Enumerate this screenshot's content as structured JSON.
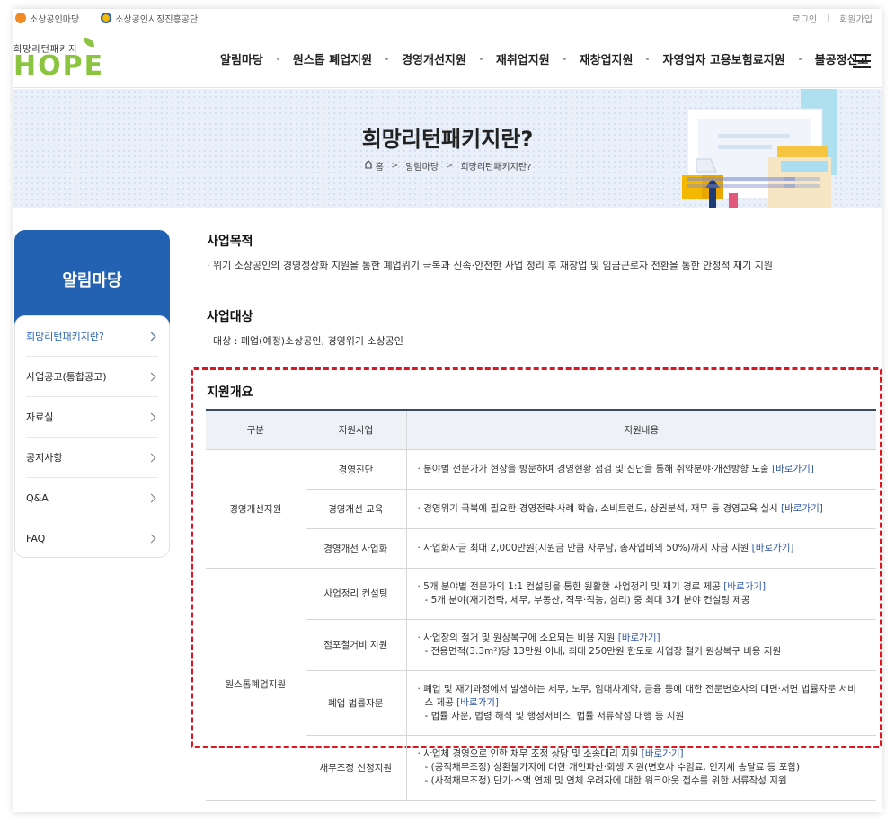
{
  "util": {
    "org1": "소상공인마당",
    "org2": "소상공인시장진흥공단",
    "login": "로그인",
    "join": "회원가입"
  },
  "logo": {
    "sub": "희망리턴패키지",
    "word": "HOPE"
  },
  "gnb": [
    "알림마당",
    "원스톱 폐업지원",
    "경영개선지원",
    "재취업지원",
    "재창업지원",
    "자영업자 고용보험료지원",
    "불공정신고"
  ],
  "banner": {
    "title": "희망리턴패키지란?",
    "breadcrumb": [
      "홈",
      "알림마당",
      "희망리턴패키지란?"
    ]
  },
  "sidebar": {
    "title": "알림마당",
    "items": [
      {
        "label": "희망리턴패키지란?",
        "active": true
      },
      {
        "label": "사업공고(통합공고)",
        "active": false
      },
      {
        "label": "자료실",
        "active": false
      },
      {
        "label": "공지사항",
        "active": false
      },
      {
        "label": "Q&A",
        "active": false
      },
      {
        "label": "FAQ",
        "active": false
      }
    ]
  },
  "purpose": {
    "title": "사업목적",
    "text": "· 위기 소상공인의 경영정상화 지원을 통한 폐업위기 극복과 신속·안전한 사업 정리 후 재창업 및 임금근로자 전환을 통한 안정적 재기 지원"
  },
  "target": {
    "title": "사업대상",
    "text": "· 대상 : 폐업(예정)소상공인, 경영위기 소상공인"
  },
  "overview": {
    "title": "지원개요",
    "headers": [
      "구분",
      "지원사업",
      "지원내용"
    ],
    "link_label": "[바로가기]",
    "groups": [
      {
        "category": "경영개선지원",
        "rows": [
          {
            "program": "경영진단",
            "lines": [
              "· 분야별 전문가가 현장을 방문하여 경영현황 점검 및 진단을 통해 취약분야·개선방향 도출"
            ],
            "sub": []
          },
          {
            "program": "경영개선 교육",
            "lines": [
              "· 경영위기 극복에 필요한 경영전략·사례 학습, 소비트렌드, 상권분석, 재무 등 경영교육 실시"
            ],
            "sub": []
          },
          {
            "program": "경영개선 사업화",
            "lines": [
              "· 사업화자금 최대 2,000만원(지원금 만큼 자부담, 총사업비의 50%)까지 자금 지원"
            ],
            "sub": []
          }
        ]
      },
      {
        "category": "원스톱폐업지원",
        "rows": [
          {
            "program": "사업정리 컨설팅",
            "lines": [
              "· 5개 분야별 전문가의 1:1 컨설팅을 통한 원활한 사업정리 및 재기 경로 제공"
            ],
            "sub": [
              "- 5개 분야(재기전략, 세무, 부동산, 직무·직능, 심리) 중 최대 3개 분야 컨설팅 제공"
            ]
          },
          {
            "program": "점포철거비 지원",
            "lines": [
              "· 사업장의 철거 및 원상복구에 소요되는 비용 지원"
            ],
            "sub": [
              "- 전용면적(3.3m²)당 13만원 이내, 최대 250만원 한도로 사업장 철거·원상복구 비용 지원"
            ]
          },
          {
            "program": "폐업 법률자문",
            "lines": [
              "· 폐업 및 재기과정에서 발생하는 세무, 노무, 임대차계약, 금융 등에 대한 전문변호사의 대면·서면 법률자문 서비",
              "스 제공"
            ],
            "sub": [
              "- 법률 자문, 법령 해석 및 행정서비스, 법률 서류작성 대행 등 지원"
            ]
          },
          {
            "program": "채무조정 신청지원",
            "lines": [
              "· 사업체 경영으로 인한 채무 조정 상담 및 소송대리 지원"
            ],
            "sub": [
              "- (공적채무조정) 상환불가자에 대한 개인파산·회생 지원(변호사 수임료, 인지세 송달료 등 포함)",
              "- (사적채무조정) 단기·소액 연체 및 연체 우려자에 대한 워크아웃 접수를 위한 서류작성 지원"
            ]
          }
        ]
      }
    ]
  },
  "colors": {
    "brand_blue": "#2361b2",
    "logo_green": "#8bc53f",
    "highlight_red": "#e0161e",
    "link_blue": "#2f55a4"
  }
}
